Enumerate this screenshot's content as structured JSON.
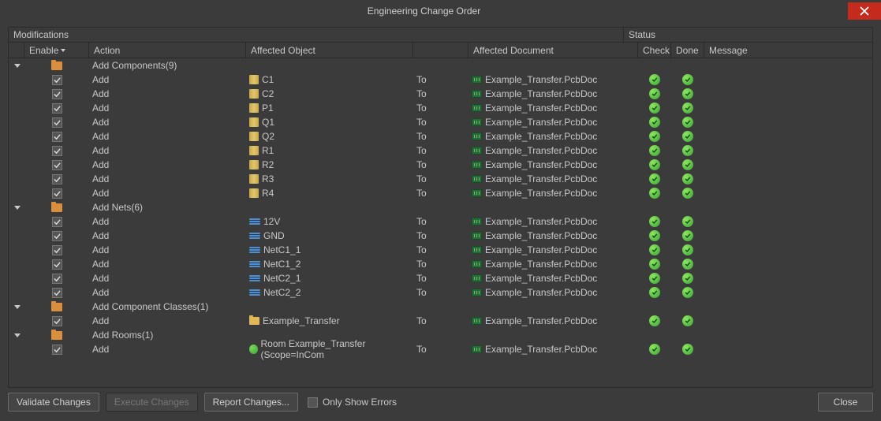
{
  "window": {
    "title": "Engineering Change Order"
  },
  "headers": {
    "modifications": "Modifications",
    "status": "Status",
    "enable": "Enable",
    "action": "Action",
    "affected_object": "Affected Object",
    "affected_document": "Affected Document",
    "check": "Check",
    "done": "Done",
    "message": "Message"
  },
  "groups": [
    {
      "label": "Add Components(9)",
      "icon": "folder",
      "rows": [
        {
          "enable": true,
          "action": "Add",
          "obj_icon": "component",
          "object": "C1",
          "to": "To",
          "doc": "Example_Transfer.PcbDoc",
          "check": true,
          "done": true
        },
        {
          "enable": true,
          "action": "Add",
          "obj_icon": "component",
          "object": "C2",
          "to": "To",
          "doc": "Example_Transfer.PcbDoc",
          "check": true,
          "done": true
        },
        {
          "enable": true,
          "action": "Add",
          "obj_icon": "component",
          "object": "P1",
          "to": "To",
          "doc": "Example_Transfer.PcbDoc",
          "check": true,
          "done": true
        },
        {
          "enable": true,
          "action": "Add",
          "obj_icon": "component",
          "object": "Q1",
          "to": "To",
          "doc": "Example_Transfer.PcbDoc",
          "check": true,
          "done": true
        },
        {
          "enable": true,
          "action": "Add",
          "obj_icon": "component",
          "object": "Q2",
          "to": "To",
          "doc": "Example_Transfer.PcbDoc",
          "check": true,
          "done": true
        },
        {
          "enable": true,
          "action": "Add",
          "obj_icon": "component",
          "object": "R1",
          "to": "To",
          "doc": "Example_Transfer.PcbDoc",
          "check": true,
          "done": true
        },
        {
          "enable": true,
          "action": "Add",
          "obj_icon": "component",
          "object": "R2",
          "to": "To",
          "doc": "Example_Transfer.PcbDoc",
          "check": true,
          "done": true
        },
        {
          "enable": true,
          "action": "Add",
          "obj_icon": "component",
          "object": "R3",
          "to": "To",
          "doc": "Example_Transfer.PcbDoc",
          "check": true,
          "done": true
        },
        {
          "enable": true,
          "action": "Add",
          "obj_icon": "component",
          "object": "R4",
          "to": "To",
          "doc": "Example_Transfer.PcbDoc",
          "check": true,
          "done": true
        }
      ]
    },
    {
      "label": "Add Nets(6)",
      "icon": "folder",
      "rows": [
        {
          "enable": true,
          "action": "Add",
          "obj_icon": "net",
          "object": "12V",
          "to": "To",
          "doc": "Example_Transfer.PcbDoc",
          "check": true,
          "done": true
        },
        {
          "enable": true,
          "action": "Add",
          "obj_icon": "net",
          "object": "GND",
          "to": "To",
          "doc": "Example_Transfer.PcbDoc",
          "check": true,
          "done": true
        },
        {
          "enable": true,
          "action": "Add",
          "obj_icon": "net",
          "object": "NetC1_1",
          "to": "To",
          "doc": "Example_Transfer.PcbDoc",
          "check": true,
          "done": true
        },
        {
          "enable": true,
          "action": "Add",
          "obj_icon": "net",
          "object": "NetC1_2",
          "to": "To",
          "doc": "Example_Transfer.PcbDoc",
          "check": true,
          "done": true
        },
        {
          "enable": true,
          "action": "Add",
          "obj_icon": "net",
          "object": "NetC2_1",
          "to": "To",
          "doc": "Example_Transfer.PcbDoc",
          "check": true,
          "done": true
        },
        {
          "enable": true,
          "action": "Add",
          "obj_icon": "net",
          "object": "NetC2_2",
          "to": "To",
          "doc": "Example_Transfer.PcbDoc",
          "check": true,
          "done": true
        }
      ]
    },
    {
      "label": "Add Component Classes(1)",
      "icon": "folder",
      "rows": [
        {
          "enable": true,
          "action": "Add",
          "obj_icon": "class",
          "object": "Example_Transfer",
          "to": "To",
          "doc": "Example_Transfer.PcbDoc",
          "check": true,
          "done": true
        }
      ]
    },
    {
      "label": "Add Rooms(1)",
      "icon": "folder",
      "rows": [
        {
          "enable": true,
          "action": "Add",
          "obj_icon": "room",
          "object": "Room Example_Transfer (Scope=InCom",
          "to": "To",
          "doc": "Example_Transfer.PcbDoc",
          "check": true,
          "done": true
        }
      ]
    }
  ],
  "footer": {
    "validate": "Validate Changes",
    "execute": "Execute Changes",
    "report": "Report Changes...",
    "only_errors": "Only Show Errors",
    "close": "Close"
  }
}
